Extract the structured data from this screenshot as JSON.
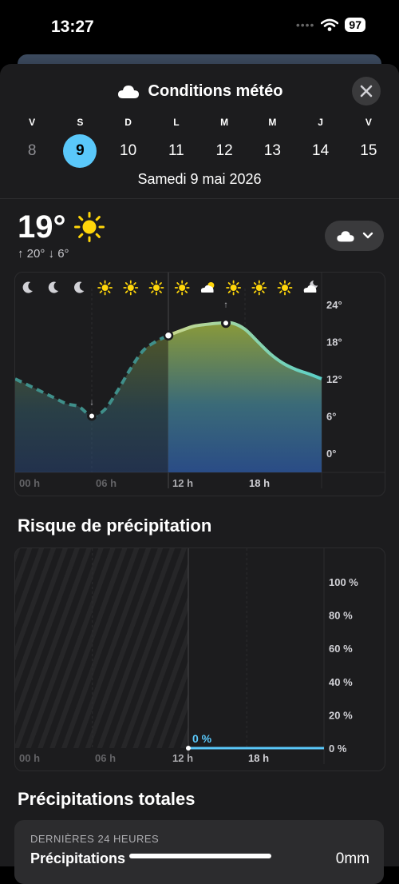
{
  "status_bar": {
    "time": "13:27",
    "battery": "97"
  },
  "header": {
    "title": "Conditions météo",
    "close_icon": "close-icon"
  },
  "days": [
    {
      "letter": "V",
      "number": "8",
      "state": "past"
    },
    {
      "letter": "S",
      "number": "9",
      "state": "selected"
    },
    {
      "letter": "D",
      "number": "10",
      "state": "future"
    },
    {
      "letter": "L",
      "number": "11",
      "state": "future"
    },
    {
      "letter": "M",
      "number": "12",
      "state": "future"
    },
    {
      "letter": "M",
      "number": "13",
      "state": "future"
    },
    {
      "letter": "J",
      "number": "14",
      "state": "future"
    },
    {
      "letter": "V",
      "number": "15",
      "state": "future"
    }
  ],
  "selected_date": "Samedi 9 mai 2026",
  "current": {
    "temp": "19°",
    "hi": "↑ 20°",
    "lo": "↓ 6°",
    "icon": "sun-icon"
  },
  "condition_button": {
    "icon": "cloud-icon"
  },
  "temperature_chart": {
    "hour_icons": [
      "moon",
      "moon",
      "moon",
      "sun",
      "sun",
      "sun",
      "sun",
      "cloud-sun",
      "sun",
      "sun",
      "sun",
      "moon-cloud"
    ],
    "y_ticks": [
      "24°",
      "18°",
      "12°",
      "6°",
      "0°"
    ],
    "x_ticks": [
      "00 h",
      "06 h",
      "12 h",
      "18 h"
    ]
  },
  "precip_section": {
    "title": "Risque de précipitation",
    "current_label": "0 %"
  },
  "precip_chart": {
    "y_ticks": [
      "100 %",
      "80 %",
      "60 %",
      "40 %",
      "20 %",
      "0 %"
    ],
    "x_ticks": [
      "00 h",
      "06 h",
      "12 h",
      "18 h"
    ]
  },
  "totals_section": {
    "title": "Précipitations totales",
    "card_label": "DERNIÈRES 24 HEURES",
    "card_title": "Précipitations",
    "card_value": "0mm"
  },
  "chart_data": [
    {
      "type": "line",
      "title": "",
      "xlabel": "",
      "ylabel": "",
      "x": [
        0,
        1,
        2,
        3,
        4,
        5,
        6,
        7,
        8,
        9,
        10,
        11,
        12,
        13,
        14,
        15,
        16,
        17,
        18,
        19,
        20,
        21,
        22,
        23,
        24
      ],
      "values": [
        12,
        11,
        10,
        9,
        8,
        7.5,
        6,
        7,
        10,
        13.5,
        16.5,
        18,
        19,
        19.8,
        20.5,
        20.8,
        21,
        21,
        20,
        18,
        16,
        14.5,
        13.5,
        12.8,
        12
      ],
      "ylim": [
        -3,
        27
      ],
      "y_ticks": [
        24,
        18,
        12,
        6,
        0
      ],
      "x_ticks": [
        "00 h",
        "06 h",
        "12 h",
        "18 h"
      ],
      "annotations": [
        {
          "x": 6,
          "y": 6,
          "label": "min"
        },
        {
          "x": 16.5,
          "y": 21,
          "label": "max"
        }
      ],
      "grid": true
    },
    {
      "type": "line",
      "title": "",
      "x": [
        13.5,
        24
      ],
      "values": [
        0,
        0
      ],
      "ylim": [
        0,
        100
      ],
      "y_ticks": [
        100,
        80,
        60,
        40,
        20,
        0
      ],
      "x_ticks": [
        "00 h",
        "06 h",
        "12 h",
        "18 h"
      ],
      "annotations": [
        {
          "x": 13.5,
          "y": 0,
          "label": "0 %"
        }
      ],
      "grid": true
    }
  ]
}
